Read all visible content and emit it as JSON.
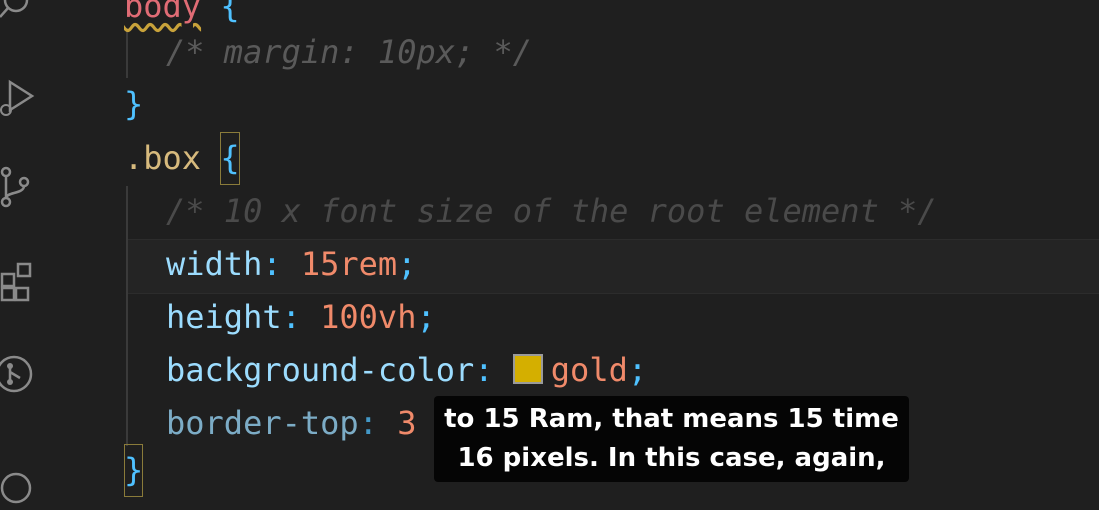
{
  "activity_bar": {
    "icons": [
      "search-icon",
      "run-debug-icon",
      "source-control-icon",
      "extensions-icon",
      "remote-icon",
      "accounts-icon"
    ]
  },
  "editor": {
    "lines": {
      "l1_selector": "body",
      "l1_brace": "{",
      "l2_comment": "/* margin: 10px; */",
      "l3_brace": "}",
      "l4_selector": ".box",
      "l4_brace": "{",
      "l5_comment": "/* 10 x font size of the root element */",
      "l6_prop": "width",
      "l6_colon": ":",
      "l6_value": "15rem",
      "l6_semi": ";",
      "l7_prop": "height",
      "l7_colon": ":",
      "l7_value": "100vh",
      "l7_semi": ";",
      "l8_prop": "background-color",
      "l8_colon": ":",
      "l8_value": "gold",
      "l8_semi": ";",
      "l9_prop": "border-top",
      "l9_colon": ":",
      "l9_value": "3",
      "l10_brace": "}"
    },
    "swatch_color": "#d4af00"
  },
  "caption": {
    "line1": "to 15 Ram, that means 15 time",
    "line2": "16 pixels. In this case, again,"
  }
}
